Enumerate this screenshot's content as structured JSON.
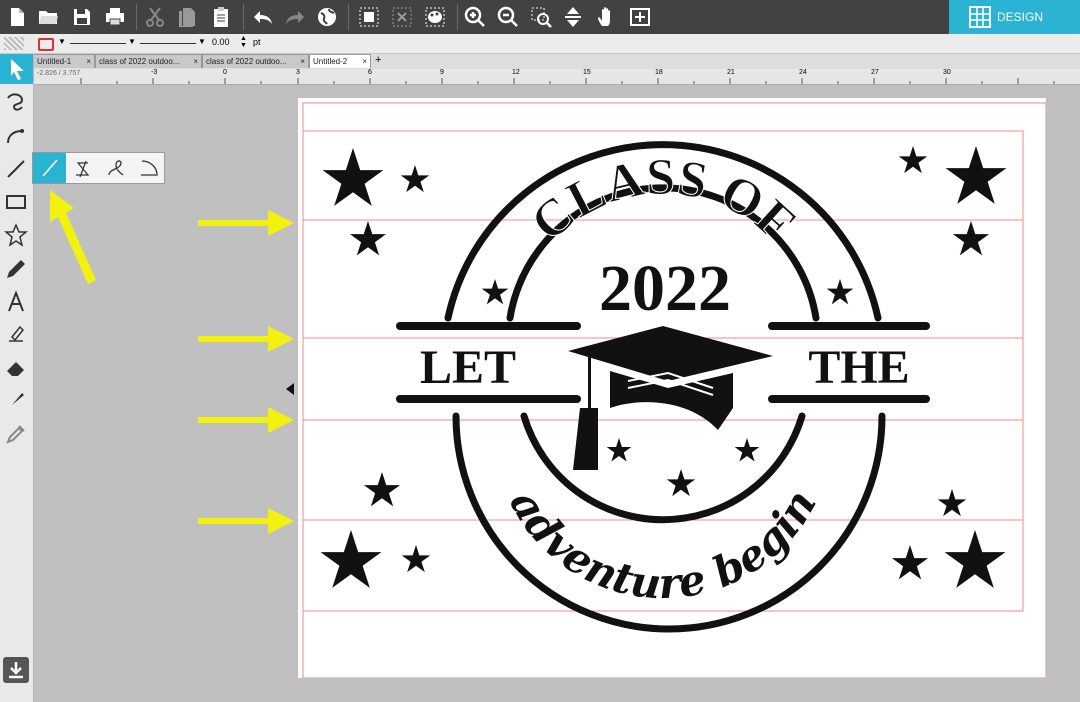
{
  "toolbar": {
    "design_label": "DESIGN",
    "icons": [
      "new-file-icon",
      "open-folder-icon",
      "save-icon",
      "print-icon",
      "cut-icon",
      "copy-icon",
      "paste-icon",
      "undo-icon",
      "redo-icon",
      "globe-icon",
      "group-icon",
      "ungroup-icon",
      "palette-icon",
      "zoom-in-icon",
      "zoom-out-icon",
      "zoom-selection-icon",
      "pan-move-icon",
      "hand-icon",
      "fit-page-icon"
    ]
  },
  "properties": {
    "line_width_value": "0.00",
    "unit": "pt"
  },
  "tabs": [
    {
      "label": "Untitled-1",
      "close": "×"
    },
    {
      "label": "class of 2022 outdoo...",
      "close": "×"
    },
    {
      "label": "class of 2022 outdoo...",
      "close": "×"
    },
    {
      "label": "Untitled-2",
      "close": "×"
    }
  ],
  "add_tab": "+",
  "ruler": {
    "coords": "-2.826 / 3.757",
    "ticks": [
      "-6",
      "-3",
      "0",
      "3",
      "6",
      "9",
      "12",
      "15",
      "18",
      "21",
      "24",
      "27",
      "30"
    ]
  },
  "design": {
    "class_of": "CLASS OF",
    "year": "2022",
    "let": "LET",
    "the": "THE",
    "adventure_begin": "adventure begin"
  },
  "colors": {
    "toolbar_bg": "#424242",
    "accent": "#2bb3d4",
    "annotation_arrow": "#f2f20e",
    "guide_line": "#f08a8a"
  }
}
